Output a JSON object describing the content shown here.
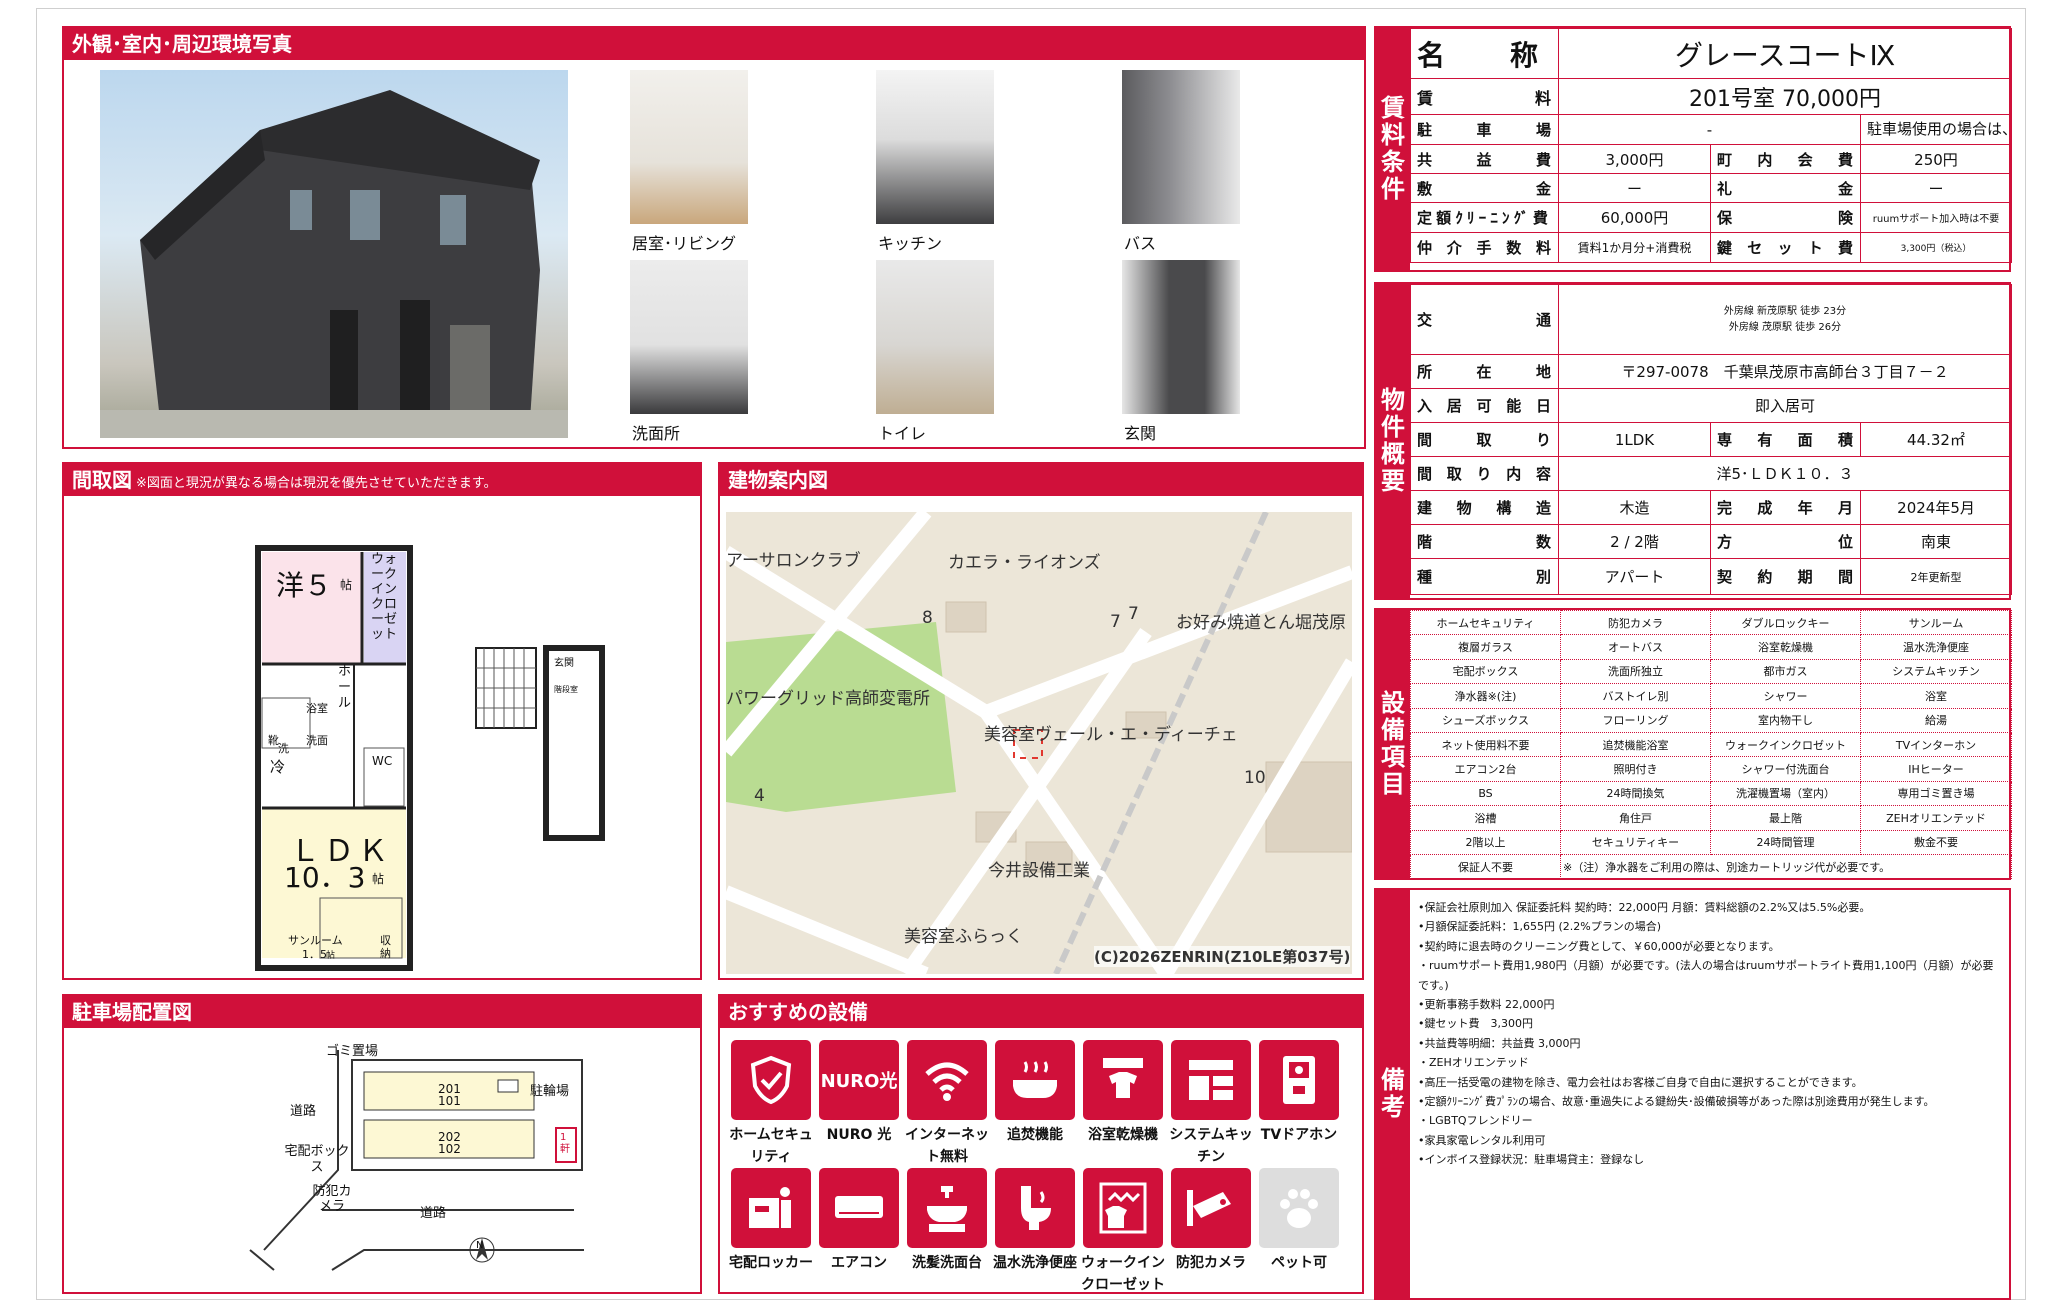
{
  "photos": {
    "title": "外観･室内･周辺環境写真",
    "items": [
      {
        "label": "居室･リビング"
      },
      {
        "label": "キッチン"
      },
      {
        "label": "バス"
      },
      {
        "label": "洗面所"
      },
      {
        "label": "トイレ"
      },
      {
        "label": "玄関"
      }
    ]
  },
  "floorplan": {
    "title": "間取図",
    "note": "※図面と現況が異なる場合は現況を優先させていただきます。",
    "rooms": {
      "western": "洋５",
      "western_unit": "帖",
      "wic": "ウォークインクローゼット",
      "bath": "浴室",
      "hall": "ホール",
      "wash": "洗面",
      "senta": "洗",
      "kutsu": "靴",
      "ref": "冷",
      "wc": "WC",
      "ldk": "ＬＤＫ",
      "ldk_size": "10．3",
      "ldk_unit": "帖",
      "sunroom": "サンルーム",
      "sunroom_size": "1．5",
      "sunroom_unit": "帖",
      "storage": "収納",
      "entrance": "玄関",
      "stairs": "階段室"
    }
  },
  "map": {
    "title": "建物案内図",
    "labels": [
      "アーサロンクラブ",
      "カエラ・ライオンズ",
      "お好み焼道とん堀茂原",
      "パワーグリッド高師変電所",
      "美容室ヴェール・エ・ディーチェ",
      "今井設備工業",
      "美容室ふらっく"
    ],
    "numbers": [
      "8",
      "7",
      "7",
      "4",
      "10"
    ],
    "copyright": "(C)2026ZENRIN(Z10LE第037号)"
  },
  "parking": {
    "title": "駐車場配置図",
    "labels": {
      "garbage": "ゴミ置場",
      "bike": "駐輪場",
      "road1": "道路",
      "road2": "道路",
      "delivery": "宅配ボックス",
      "camera": "防犯カメラ",
      "units_top": "201",
      "units_top2": "101",
      "units_bot": "202",
      "units_bot2": "102",
      "n": "N",
      "floor": "1軒"
    }
  },
  "recommend": {
    "title": "おすすめの設備",
    "items": [
      {
        "label": "ホームセキュリティ",
        "icon": "shield-icon"
      },
      {
        "label": "NURO 光",
        "icon": "nuro-icon",
        "text": "NURO光"
      },
      {
        "label": "インターネット無料",
        "icon": "wifi-icon"
      },
      {
        "label": "追焚機能",
        "icon": "bathtub-icon"
      },
      {
        "label": "浴室乾燥機",
        "icon": "bath-dryer-icon"
      },
      {
        "label": "システムキッチン",
        "icon": "kitchen-icon"
      },
      {
        "label": "TVドアホン",
        "icon": "intercom-icon"
      },
      {
        "label": "宅配ロッカー",
        "icon": "locker-icon"
      },
      {
        "label": "エアコン",
        "icon": "aircon-icon"
      },
      {
        "label": "洗髪洗面台",
        "icon": "washbasin-icon"
      },
      {
        "label": "温水洗浄便座",
        "icon": "toilet-icon"
      },
      {
        "label": "ウォークインクローゼット",
        "icon": "closet-icon"
      },
      {
        "label": "防犯カメラ",
        "icon": "camera-icon"
      },
      {
        "label": "ペット可",
        "icon": "paw-icon"
      }
    ]
  },
  "rent": {
    "label": "賃料条件",
    "name_l": "名　称",
    "name_v": "グレースコートⅨ",
    "rent_l": "賃料",
    "rent_v": "201号室 70,000円",
    "parking_l": "駐車場",
    "parking_v": "-",
    "parking_note": "駐車場使用の場合は、別途手数料（駐車料+消費税）が必要です。",
    "common_l": "共益費",
    "common_v": "3,000円",
    "town_l": "町内会費",
    "town_v": "250円",
    "deposit_l": "敷金",
    "deposit_v": "ー",
    "key_money_l": "礼金",
    "key_money_v": "ー",
    "clean_l": "定額ｸﾘｰﾆﾝｸﾞ費",
    "clean_v": "60,000円",
    "ins_l": "保険",
    "ins_v": "ruumサポート加入時は不要",
    "broker_l": "仲介手数料",
    "broker_v": "賃料1か月分+消費税",
    "keyset_l": "鍵セット費",
    "keyset_v": "3,300円（税込）"
  },
  "outline": {
    "label": "物件概要",
    "access_l": "交通",
    "access_v1": "外房線 新茂原駅 徒歩 23分",
    "access_v2": "外房線 茂原駅 徒歩 26分",
    "addr_l": "所在地",
    "addr_v": "〒297-0078　千葉県茂原市高師台３丁目７－２",
    "move_l": "入居可能日",
    "move_v": "即入居可",
    "layout_l": "間取り",
    "layout_v": "1LDK",
    "area_l": "専有面積",
    "area_v": "44.32㎡",
    "detail_l": "間取り内容",
    "detail_v": "洋5･ＬＤＫ１０．３",
    "struct_l": "建物構造",
    "struct_v": "木造",
    "built_l": "完成年月",
    "built_v": "2024年5月",
    "floor_l": "階数",
    "floor_v": "2 / 2階",
    "dir_l": "方位",
    "dir_v": "南東",
    "type_l": "種別",
    "type_v": "アパート",
    "contract_l": "契約期間",
    "contract_v": "2年更新型"
  },
  "equipment": {
    "label": "設備項目",
    "rows": [
      [
        "ホームセキュリティ",
        "防犯カメラ",
        "ダブルロックキー",
        "サンルーム"
      ],
      [
        "複層ガラス",
        "オートバス",
        "浴室乾燥機",
        "温水洗浄便座"
      ],
      [
        "宅配ボックス",
        "洗面所独立",
        "都市ガス",
        "システムキッチン"
      ],
      [
        "浄水器※(注)",
        "バストイレ別",
        "シャワー",
        "浴室"
      ],
      [
        "シューズボックス",
        "フローリング",
        "室内物干し",
        "給湯"
      ],
      [
        "ネット使用料不要",
        "追焚機能浴室",
        "ウォークインクロゼット",
        "TVインターホン"
      ],
      [
        "エアコン2台",
        "照明付き",
        "シャワー付洗面台",
        "IHヒーター"
      ],
      [
        "BS",
        "24時間換気",
        "洗濯機置場（室内）",
        "専用ゴミ置き場"
      ],
      [
        "浴槽",
        "角住戸",
        "最上階",
        "ZEHオリエンテッド"
      ],
      [
        "2階以上",
        "セキュリティキー",
        "24時間管理",
        "敷金不要"
      ]
    ],
    "last_first": "保証人不要",
    "last_note": "※（注）浄水器をご利用の際は、別途カートリッジ代が必要です。"
  },
  "remarks": {
    "label": "備考",
    "lines": [
      "•保証会社原則加入 保証委託料 契約時：22,000円 月額：賃料総額の2.2%又は5.5%必要。",
      "•月額保証委託料：1,655円 (2.2%プランの場合)",
      "•契約時に退去時のクリーニング費として、￥60,000が必要となります。",
      "・ruumサポート費用1,980円（月額）が必要です。(法人の場合はruumサポートライト費用1,100円（月額）が必要です。)",
      "•更新事務手数料 22,000円",
      "•鍵セット費　3,300円",
      "•共益費等明細：共益費 3,000円",
      "・ZEHオリエンテッド",
      "•高圧一括受電の建物を除き、電力会社はお客様ご自身で自由に選択することができます。",
      "•定額ｸﾘｰﾆﾝｸﾞ費ﾌﾟﾗﾝの場合、故意･重過失による鍵紛失･設備破損等があった際は別途費用が発生します。",
      "・LGBTQフレンドリー",
      "•家具家電レンタル利用可",
      "•インボイス登録状況：駐車場貸主：登録なし"
    ]
  }
}
